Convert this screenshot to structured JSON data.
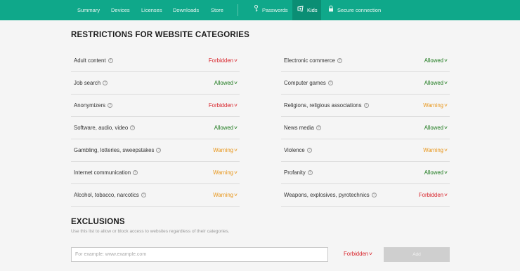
{
  "nav": {
    "items": [
      {
        "label": "Summary"
      },
      {
        "label": "Devices"
      },
      {
        "label": "Licenses"
      },
      {
        "label": "Downloads"
      },
      {
        "label": "Store"
      },
      {
        "label": "Passwords",
        "icon": "key-icon"
      },
      {
        "label": "Kids",
        "icon": "kids-icon",
        "active": true
      },
      {
        "label": "Secure connection",
        "icon": "lock-icon"
      }
    ]
  },
  "restrictions": {
    "title": "RESTRICTIONS FOR WEBSITE CATEGORIES",
    "left": [
      {
        "label": "Adult content",
        "status": "Forbidden"
      },
      {
        "label": "Job search",
        "status": "Allowed"
      },
      {
        "label": "Anonymizers",
        "status": "Forbidden"
      },
      {
        "label": "Software, audio, video",
        "status": "Allowed"
      },
      {
        "label": "Gambling, lotteries, sweepstakes",
        "status": "Warning"
      },
      {
        "label": "Internet communication",
        "status": "Warning"
      },
      {
        "label": "Alcohol, tobacco, narcotics",
        "status": "Warning"
      }
    ],
    "right": [
      {
        "label": "Electronic commerce",
        "status": "Allowed"
      },
      {
        "label": "Computer games",
        "status": "Allowed"
      },
      {
        "label": "Religions, religious associations",
        "status": "Warning"
      },
      {
        "label": "News media",
        "status": "Allowed"
      },
      {
        "label": "Violence",
        "status": "Warning"
      },
      {
        "label": "Profanity",
        "status": "Allowed"
      },
      {
        "label": "Weapons, explosives, pyrotechnics",
        "status": "Forbidden"
      }
    ]
  },
  "exclusions": {
    "title": "EXCLUSIONS",
    "description": "Use this list to allow or block access to websites regardless of their categories.",
    "input_placeholder": "For example: www.example.com",
    "input_value": "",
    "status": "Forbidden",
    "add_label": "Add"
  },
  "colors": {
    "nav_bg": "#0fa88a",
    "nav_active_bg": "#0b8e74",
    "Forbidden": "#d8232a",
    "Allowed": "#1e7a1e",
    "Warning": "#e8961a"
  }
}
